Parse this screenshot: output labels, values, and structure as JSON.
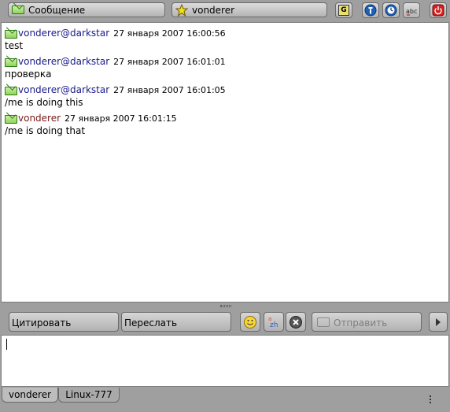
{
  "header": {
    "message_type_label": "Сообщение",
    "contact_label": "vonderer"
  },
  "log": [
    {
      "nick": "vonderer@darkstar",
      "time": "27 января 2007 16:00:56",
      "text": "test",
      "self": false
    },
    {
      "nick": "vonderer@darkstar",
      "time": "27 января 2007 16:01:01",
      "text": "проверка",
      "self": false
    },
    {
      "nick": "vonderer@darkstar",
      "time": "27 января 2007 16:01:05",
      "text": "/me is doing this",
      "self": false
    },
    {
      "nick": "vonderer",
      "time": "27 января 2007 16:01:15",
      "text": "/me is doing that",
      "self": true
    }
  ],
  "toolbar": {
    "quote_label": "Цитировать",
    "forward_label": "Переслать",
    "send_label": "Отправить"
  },
  "input": {
    "value": ""
  },
  "tabs": [
    {
      "label": "vonderer",
      "active": true
    },
    {
      "label": "Linux-777",
      "active": false
    }
  ],
  "colors": {
    "nick_other": "#1a1a8a",
    "nick_self": "#7a1a1a"
  }
}
